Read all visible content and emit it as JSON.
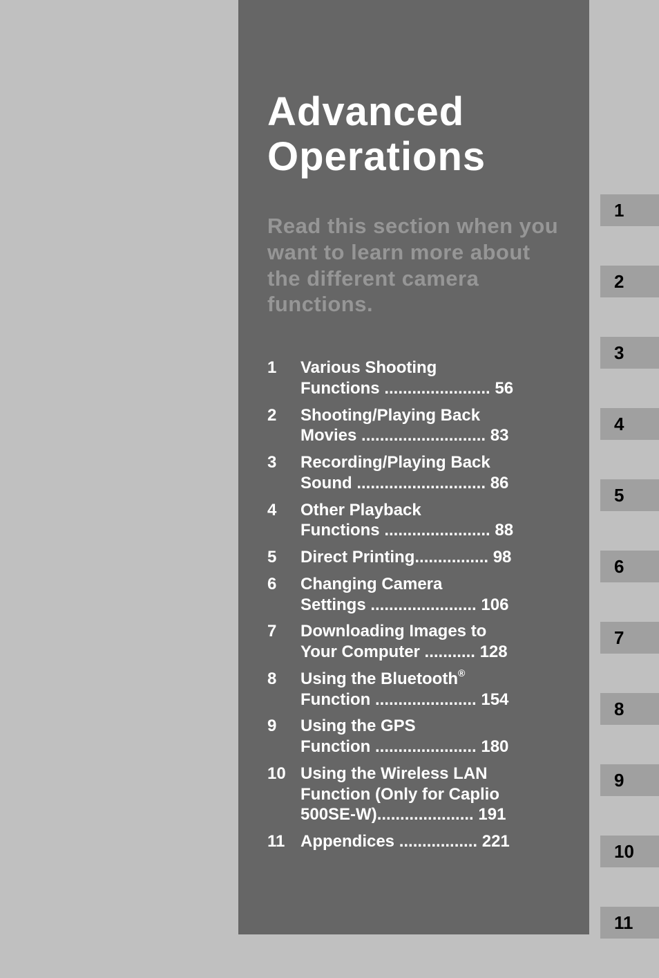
{
  "title": "Advanced Operations",
  "subtitle": "Read this section when you want to learn more about the different camera functions.",
  "toc": [
    {
      "num": "1",
      "label": "Various Shooting\nFunctions ....................... 56"
    },
    {
      "num": "2",
      "label": "Shooting/Playing Back\nMovies ........................... 83"
    },
    {
      "num": "3",
      "label": "Recording/Playing Back\nSound ............................ 86"
    },
    {
      "num": "4",
      "label": "Other Playback\nFunctions ....................... 88"
    },
    {
      "num": "5",
      "label": "Direct Printing................ 98"
    },
    {
      "num": "6",
      "label": "Changing Camera\nSettings ....................... 106"
    },
    {
      "num": "7",
      "label": "Downloading Images to\nYour Computer ........... 128"
    },
    {
      "num": "8",
      "label": "Using the Bluetooth®\nFunction ...................... 154",
      "super": "®"
    },
    {
      "num": "9",
      "label": "Using the GPS\nFunction ...................... 180"
    },
    {
      "num": "10",
      "label": "Using the Wireless LAN\nFunction (Only for Caplio\n500SE-W)..................... 191"
    },
    {
      "num": "11",
      "label": "Appendices ................. 221"
    }
  ],
  "tabs": [
    "1",
    "2",
    "3",
    "4",
    "5",
    "6",
    "7",
    "8",
    "9",
    "10",
    "11"
  ]
}
